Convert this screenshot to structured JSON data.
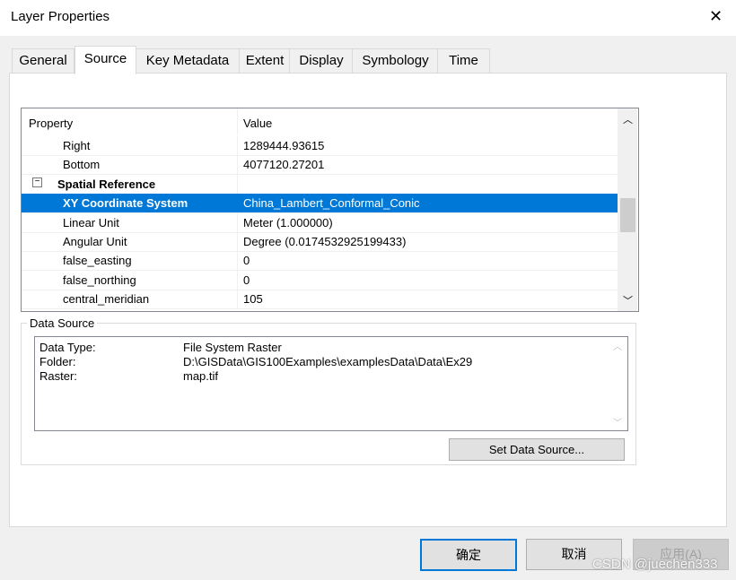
{
  "window": {
    "title": "Layer Properties",
    "close": "✕"
  },
  "tabs": [
    "General",
    "Source",
    "Key Metadata",
    "Extent",
    "Display",
    "Symbology",
    "Time"
  ],
  "grid": {
    "headers": [
      "Property",
      "Value"
    ],
    "rows": [
      {
        "p": "Right",
        "v": "1289444.93615"
      },
      {
        "p": "Bottom",
        "v": "4077120.27201"
      },
      {
        "p": "Spatial Reference",
        "v": "",
        "group": true,
        "toggle": "−"
      },
      {
        "p": "XY Coordinate System",
        "v": "China_Lambert_Conformal_Conic",
        "selected": true
      },
      {
        "p": "Linear Unit",
        "v": "Meter (1.000000)"
      },
      {
        "p": "Angular Unit",
        "v": "Degree (0.0174532925199433)"
      },
      {
        "p": "false_easting",
        "v": "0"
      },
      {
        "p": "false_northing",
        "v": "0"
      },
      {
        "p": "central_meridian",
        "v": "105"
      }
    ]
  },
  "data_source": {
    "legend": "Data Source",
    "items": [
      {
        "k": "Data Type:",
        "v": "File System Raster"
      },
      {
        "k": "Folder:",
        "v": "D:\\GISData\\GIS100Examples\\examplesData\\Data\\Ex29"
      },
      {
        "k": "Raster:",
        "v": "map.tif"
      }
    ],
    "button": "Set Data Source..."
  },
  "buttons": {
    "ok": "确定",
    "cancel": "取消",
    "apply": "应用(A)"
  },
  "watermark": "CSDN @juechen333"
}
